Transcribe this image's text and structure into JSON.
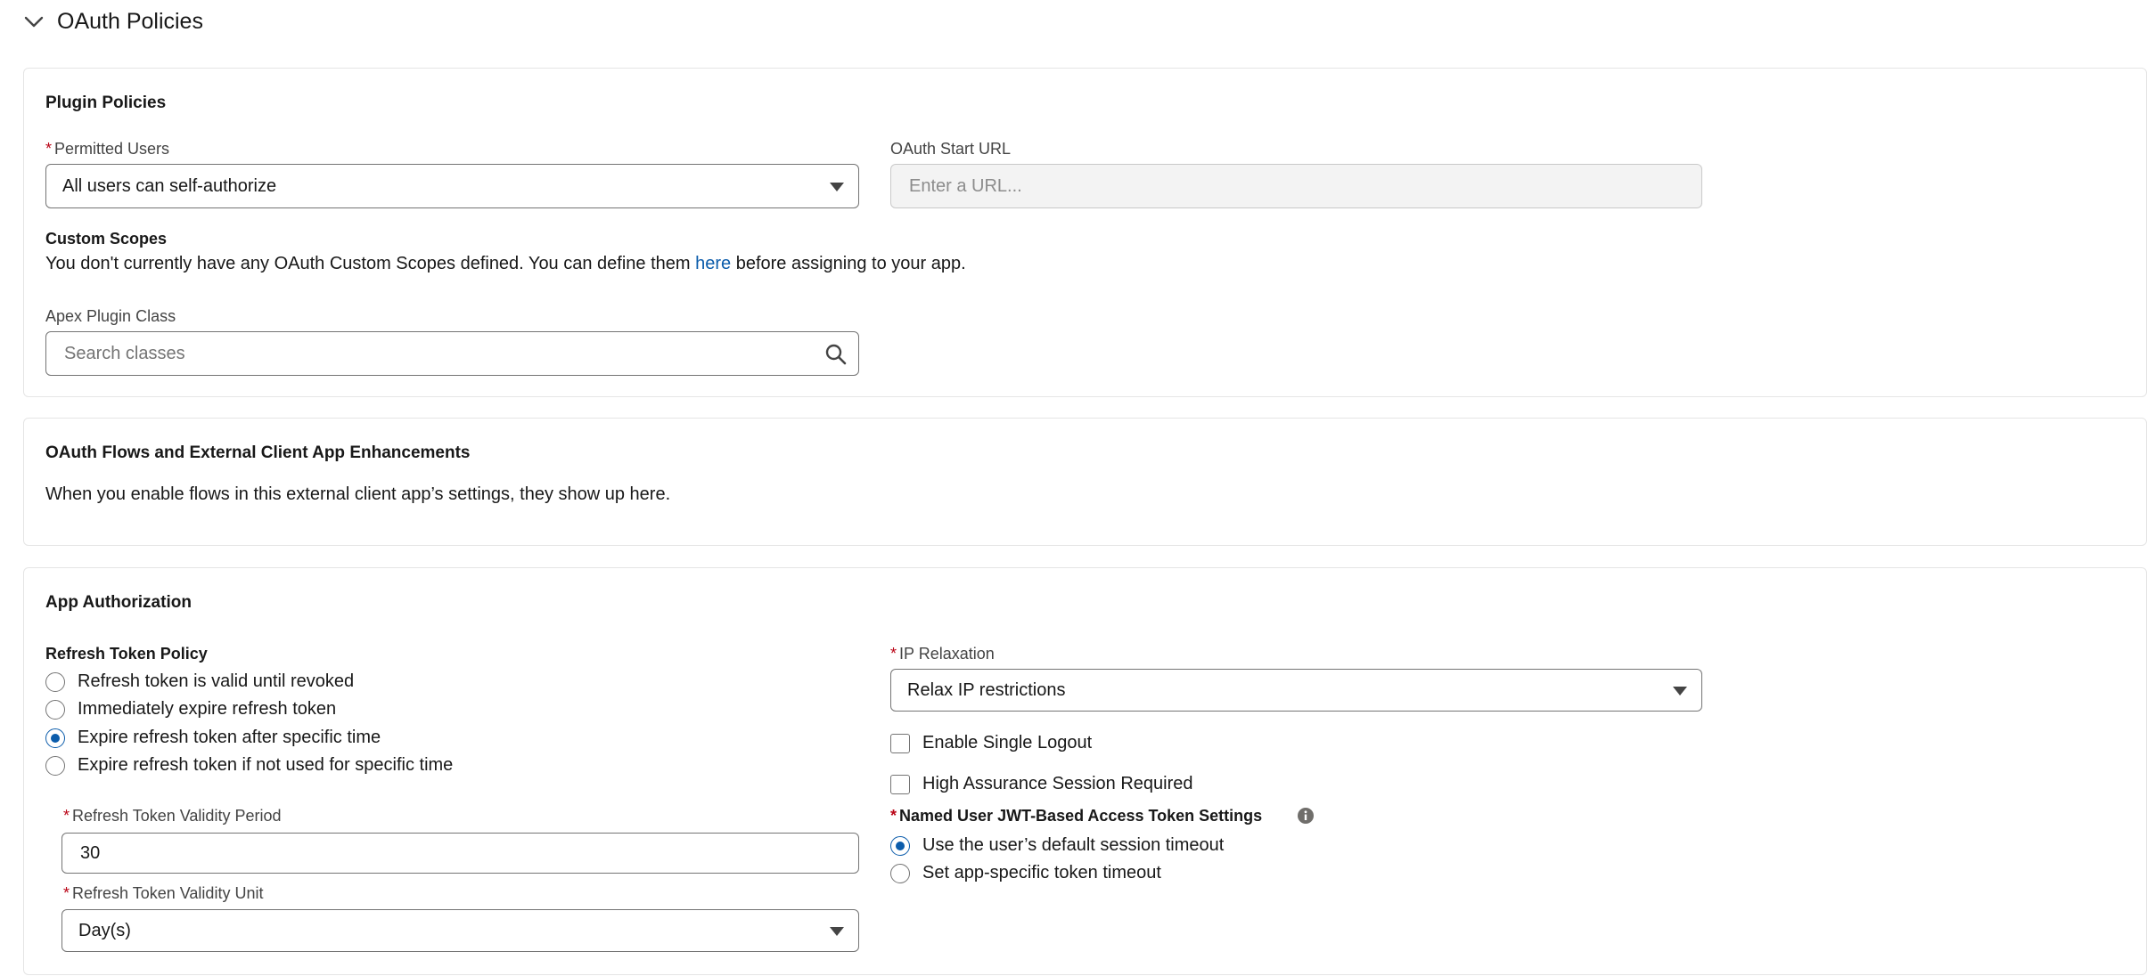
{
  "section": {
    "title": "OAuth Policies",
    "icon": "chevron-down-icon"
  },
  "plugin_policies": {
    "title": "Plugin Policies",
    "permitted_users": {
      "label": "Permitted Users",
      "required_mark": "*",
      "value": "All users can self-authorize"
    },
    "oauth_start_url": {
      "label": "OAuth Start URL",
      "placeholder": "Enter a URL..."
    },
    "custom_scopes": {
      "label": "Custom Scopes",
      "text_before": "You don't currently have any OAuth Custom Scopes defined. You can define them ",
      "link": "here",
      "text_after": " before assigning to your app."
    },
    "apex_plugin_class": {
      "label": "Apex Plugin Class",
      "placeholder": "Search classes",
      "icon": "search-icon"
    }
  },
  "oauth_flows": {
    "title": "OAuth Flows and External Client App Enhancements",
    "description": "When you enable flows in this external client app’s settings, they show up here."
  },
  "app_authorization": {
    "title": "App Authorization",
    "refresh_token_policy": {
      "label": "Refresh Token Policy",
      "options": [
        {
          "label": "Refresh token is valid until revoked",
          "checked": false
        },
        {
          "label": "Immediately expire refresh token",
          "checked": false
        },
        {
          "label": "Expire refresh token after specific time",
          "checked": true
        },
        {
          "label": "Expire refresh token if not used for specific time",
          "checked": false
        }
      ]
    },
    "validity_period": {
      "label": "Refresh Token Validity Period",
      "required_mark": "*",
      "value": "30"
    },
    "validity_unit": {
      "label": "Refresh Token Validity Unit",
      "required_mark": "*",
      "value": "Day(s)"
    },
    "ip_relaxation": {
      "label": "IP Relaxation",
      "required_mark": "*",
      "value": "Relax IP restrictions"
    },
    "enable_single_logout": {
      "label": "Enable Single Logout",
      "checked": false
    },
    "high_assurance": {
      "label": "High Assurance Session Required",
      "checked": false
    },
    "jwt_settings": {
      "label": "Named User JWT-Based Access Token Settings",
      "required_mark": "*",
      "info_icon": "info-icon",
      "options": [
        {
          "label": "Use the user’s default session timeout",
          "checked": true
        },
        {
          "label": "Set app-specific token timeout",
          "checked": false
        }
      ]
    }
  },
  "colors": {
    "link": "#0b5cab",
    "required": "#ba0517",
    "radio_selected": "#0b5cab",
    "border": "#747474"
  }
}
